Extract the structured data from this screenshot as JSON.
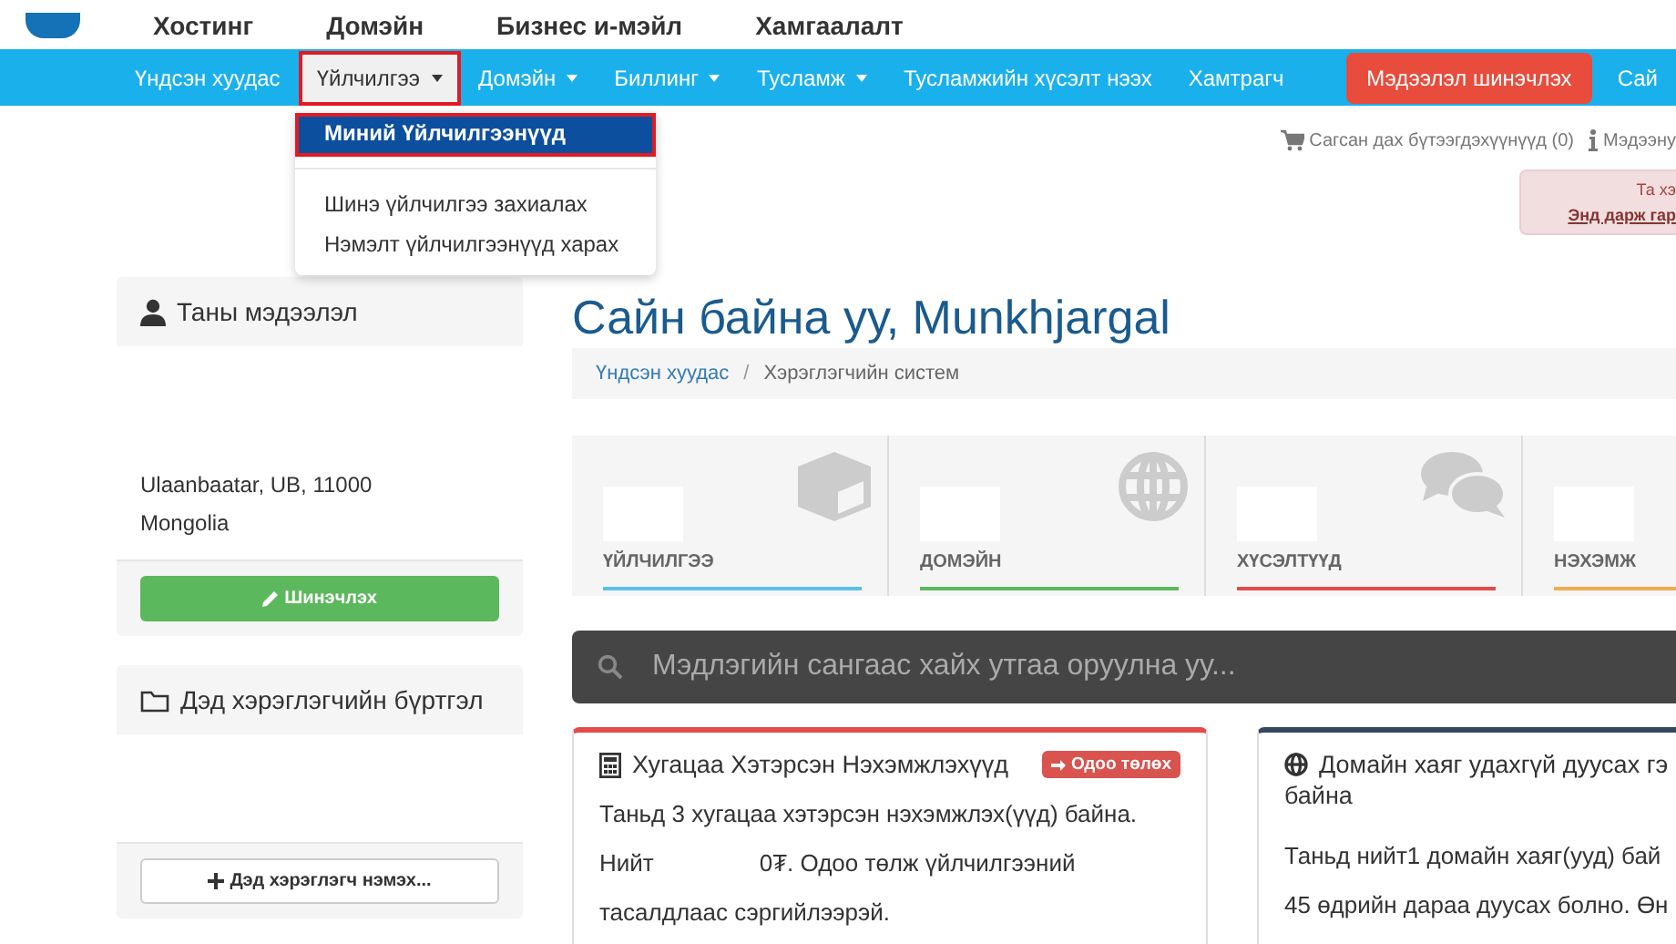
{
  "header": {
    "links": [
      "Хостинг",
      "Домэйн",
      "Бизнес и-мэйл",
      "Хамгаалалт"
    ]
  },
  "nav": {
    "items": [
      {
        "label": "Үндсэн хуудас",
        "kind": "link",
        "selected": false
      },
      {
        "label": "Үйлчилгээ",
        "kind": "dropdown",
        "selected": true
      },
      {
        "label": "Домэйн",
        "kind": "dropdown",
        "selected": false
      },
      {
        "label": "Биллинг",
        "kind": "dropdown",
        "selected": false
      },
      {
        "label": "Тусламж",
        "kind": "dropdown",
        "selected": false
      },
      {
        "label": "Тусламжийн хүсэлт нээх",
        "kind": "link",
        "selected": false
      },
      {
        "label": "Хамтрагч",
        "kind": "link",
        "selected": false
      },
      {
        "label": "Мэдээлэл шинэчлэх",
        "kind": "button",
        "selected": false
      },
      {
        "label": "Сай",
        "kind": "link",
        "selected": false
      }
    ]
  },
  "dropdown": {
    "items": [
      {
        "label": "Миний Үйлчилгээнүүд",
        "selected": true
      },
      {
        "label": "Шинэ үйлчилгээ захиалах",
        "selected": false
      },
      {
        "label": "Нэмэлт үйлчилгээнүүд харах",
        "selected": false
      }
    ]
  },
  "sidebar": {
    "panels": [
      {
        "title": "Таны мэдээлэл",
        "lines": [
          "Ulaanbaatar, UB, 11000",
          "Mongolia"
        ],
        "button": "Шинэчлэх"
      },
      {
        "title": "Дэд хэрэглэгчийн бүртгэл",
        "button": "Дэд хэрэглэгч нэмэх..."
      }
    ]
  },
  "top_links": [
    {
      "label": "Сагсан дах бүтээгдэхүүнүүд (0)"
    },
    {
      "label": "Мэдээну"
    }
  ],
  "alert": {
    "text": "Та хэ",
    "link": "Энд дарж гар"
  },
  "title": "Сайн байна уу, Munkhjargal",
  "breadcrumb": [
    {
      "label": "Үндсэн хуудас",
      "selected": false
    },
    {
      "separator": "/",
      "label": "Хэрэглэгчийн систем",
      "selected": true
    }
  ],
  "tiles": [
    {
      "label": "ҮЙЛЧИЛГЭЭ",
      "color": "#5bc0e9"
    },
    {
      "label": "ДОМЭЙН",
      "color": "#5cb85c"
    },
    {
      "label": "ХҮСЭЛТҮҮД",
      "color": "#e24c4b"
    },
    {
      "label": "НЭХЭМЖ",
      "color": "#f0ad4e"
    }
  ],
  "search": {
    "placeholder": "Мэдлэгийн сангаас хайх утгаа оруулна уу..."
  },
  "panels": [
    {
      "title": "Хугацаа Хэтэрсэн Нэхэмжлэхүүд",
      "color": "#e24c4b",
      "badge": "Одоо төлөх",
      "lines": [
        "Таньд 3 хугацаа хэтэрсэн нэхэмжлэх(үүд) байна.",
        "Нийт",
        "0₮. Одоо төлж үйлчилгээний",
        "тасалдлаас сэргийлээрэй."
      ]
    },
    {
      "title": "Домайн хаяг удахгүй дуусах гэ",
      "title_2": "байна",
      "color": "#34495e",
      "lines": [
        "Таньд нийт1 домайн хаяг(ууд) бай",
        "45 өдрийн дараа дуусах болно. Өн"
      ]
    }
  ]
}
